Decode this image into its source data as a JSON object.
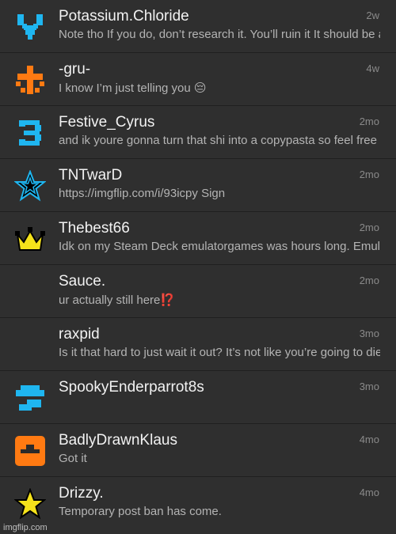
{
  "conversations": [
    {
      "name": "Potassium.Chloride",
      "time": "2w",
      "message": "Note tho If you do, don’t research it. You’ll ruin it It should be a surprise",
      "avatar": "blue-heart-pixel-icon"
    },
    {
      "name": "-gru-",
      "time": "4w",
      "message": "I know I’m just telling you 😔",
      "avatar": "orange-cross-pixel-icon"
    },
    {
      "name": "Festive_Cyrus",
      "time": "2mo",
      "message": "and ik youre gonna turn that shi into a copypasta so feel free",
      "avatar": "blue-three-pixel-icon"
    },
    {
      "name": "TNTwarD",
      "time": "2mo",
      "message": "https://imgflip.com/i/93icpy Sign",
      "avatar": "blue-star-icon"
    },
    {
      "name": "Thebest66",
      "time": "2mo",
      "message": "Idk on my Steam Deck emulatorgames was hours long. Emulators",
      "avatar": "crown-icon"
    },
    {
      "name": "Sauce.",
      "time": "2mo",
      "message": "ur actually still here⁉️",
      "avatar": "no-avatar"
    },
    {
      "name": "raxpid",
      "time": "3mo",
      "message": "Is it that hard to just wait it out? It’s not like you’re going to die",
      "avatar": "no-avatar"
    },
    {
      "name": "SpookyEnderparrot8s",
      "time": "3mo",
      "message": "",
      "avatar": "blue-mushroom-pixel-icon"
    },
    {
      "name": "BadlyDrawnKlaus",
      "time": "4mo",
      "message": "Got it",
      "avatar": "orange-box-icon"
    },
    {
      "name": "Drizzy.",
      "time": "4mo",
      "message": "Temporary post ban has come.",
      "avatar": "yellow-star-icon"
    }
  ],
  "watermark": "imgflip.com",
  "colors": {
    "background": "#2f2f2f",
    "name": "#f2f2f2",
    "message": "#b4b4b4",
    "time": "#8a8a8a",
    "accent_blue": "#1fb6f0",
    "accent_orange": "#ff7a12",
    "accent_yellow": "#f5e21b"
  }
}
